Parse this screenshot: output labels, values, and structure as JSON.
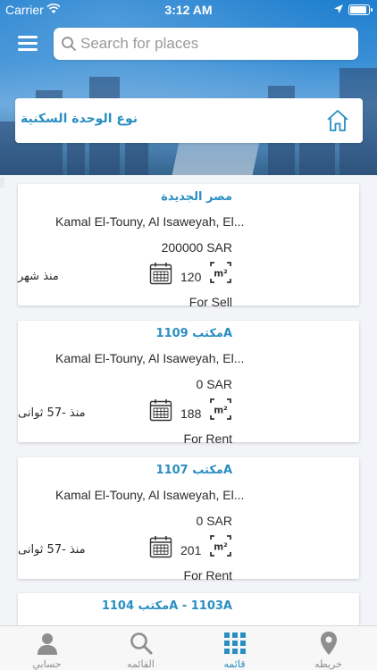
{
  "status_bar": {
    "carrier": "Carrier",
    "time": "3:12 AM"
  },
  "header": {
    "menu_icon": "hamburger-menu-icon",
    "search_placeholder": "Search for places"
  },
  "filter": {
    "unit_type_label": "نوع الوحدة السكنية",
    "icon": "home-icon"
  },
  "listings": [
    {
      "title": "مصر الجديدة",
      "address": "Kamal El-Touny, Al Isaweyah, El...",
      "price": "200000 SAR",
      "area": "120",
      "posted": "منذ شهر",
      "type": "For Sell"
    },
    {
      "title": "مكتب 1109A",
      "address": "Kamal El-Touny, Al Isaweyah, El...",
      "price": "0 SAR",
      "area": "188",
      "posted": "منذ -57 ثوانى",
      "type": "For Rent"
    },
    {
      "title": "مكتب 1107A",
      "address": "Kamal El-Touny, Al Isaweyah, El...",
      "price": "0 SAR",
      "area": "201",
      "posted": "منذ -57 ثوانى",
      "type": "For Rent"
    },
    {
      "title": "مكتب 1104A - 1103A"
    }
  ],
  "tabbar": {
    "tabs": [
      {
        "label": "حسابي",
        "icon": "person-icon",
        "active": false
      },
      {
        "label": "القائمه",
        "icon": "search-icon",
        "active": false
      },
      {
        "label": "قائمه",
        "icon": "grid-icon",
        "active": true
      },
      {
        "label": "خريطه",
        "icon": "map-pin-icon",
        "active": false
      }
    ]
  },
  "colors": {
    "accent": "#2a8ec2",
    "inactive": "#8e8e8e"
  }
}
